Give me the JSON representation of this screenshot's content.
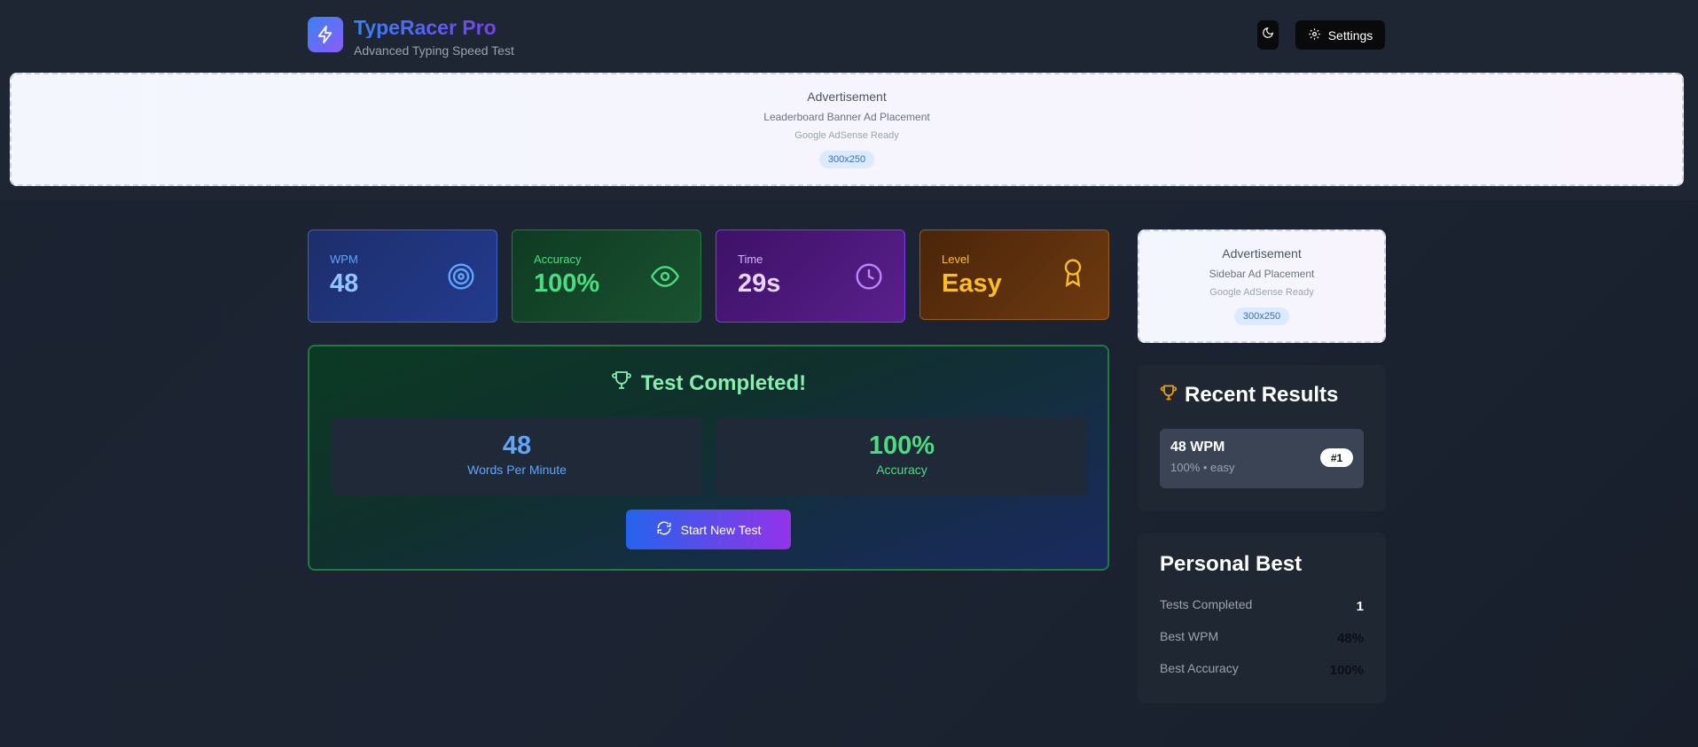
{
  "app": {
    "title": "TypeRacer Pro",
    "subtitle": "Advanced Typing Speed Test",
    "settings_label": "Settings"
  },
  "ads": {
    "banner": {
      "title": "Advertisement",
      "subtitle": "Leaderboard Banner Ad Placement",
      "ready": "Google AdSense Ready",
      "size": "300x250"
    },
    "sidebar": {
      "title": "Advertisement",
      "subtitle": "Sidebar Ad Placement",
      "ready": "Google AdSense Ready",
      "size": "300x250"
    }
  },
  "stats": {
    "wpm": {
      "label": "WPM",
      "value": "48",
      "icon": "target-icon"
    },
    "accuracy": {
      "label": "Accuracy",
      "value": "100%",
      "icon": "eye-icon"
    },
    "time": {
      "label": "Time",
      "value": "29s",
      "icon": "clock-icon"
    },
    "level": {
      "label": "Level",
      "value": "Easy",
      "icon": "award-icon"
    }
  },
  "completion": {
    "title": "Test Completed!",
    "wpm_value": "48",
    "wpm_caption": "Words Per Minute",
    "accuracy_value": "100%",
    "accuracy_caption": "Accuracy",
    "button_label": "Start New Test"
  },
  "recent_results": {
    "title": "Recent Results",
    "items": [
      {
        "wpm": "48 WPM",
        "meta": "100% • easy",
        "rank": "#1"
      }
    ]
  },
  "personal_best": {
    "title": "Personal Best",
    "rows": [
      {
        "label": "Tests Completed",
        "value": "1"
      },
      {
        "label": "Best WPM",
        "value": "48%"
      },
      {
        "label": "Best Accuracy",
        "value": "100%"
      }
    ]
  },
  "colors": {
    "accent_blue": "#3b82f6",
    "accent_purple": "#8b5cf6",
    "success_green": "#4ade80",
    "warning_amber": "#fbbf24"
  }
}
